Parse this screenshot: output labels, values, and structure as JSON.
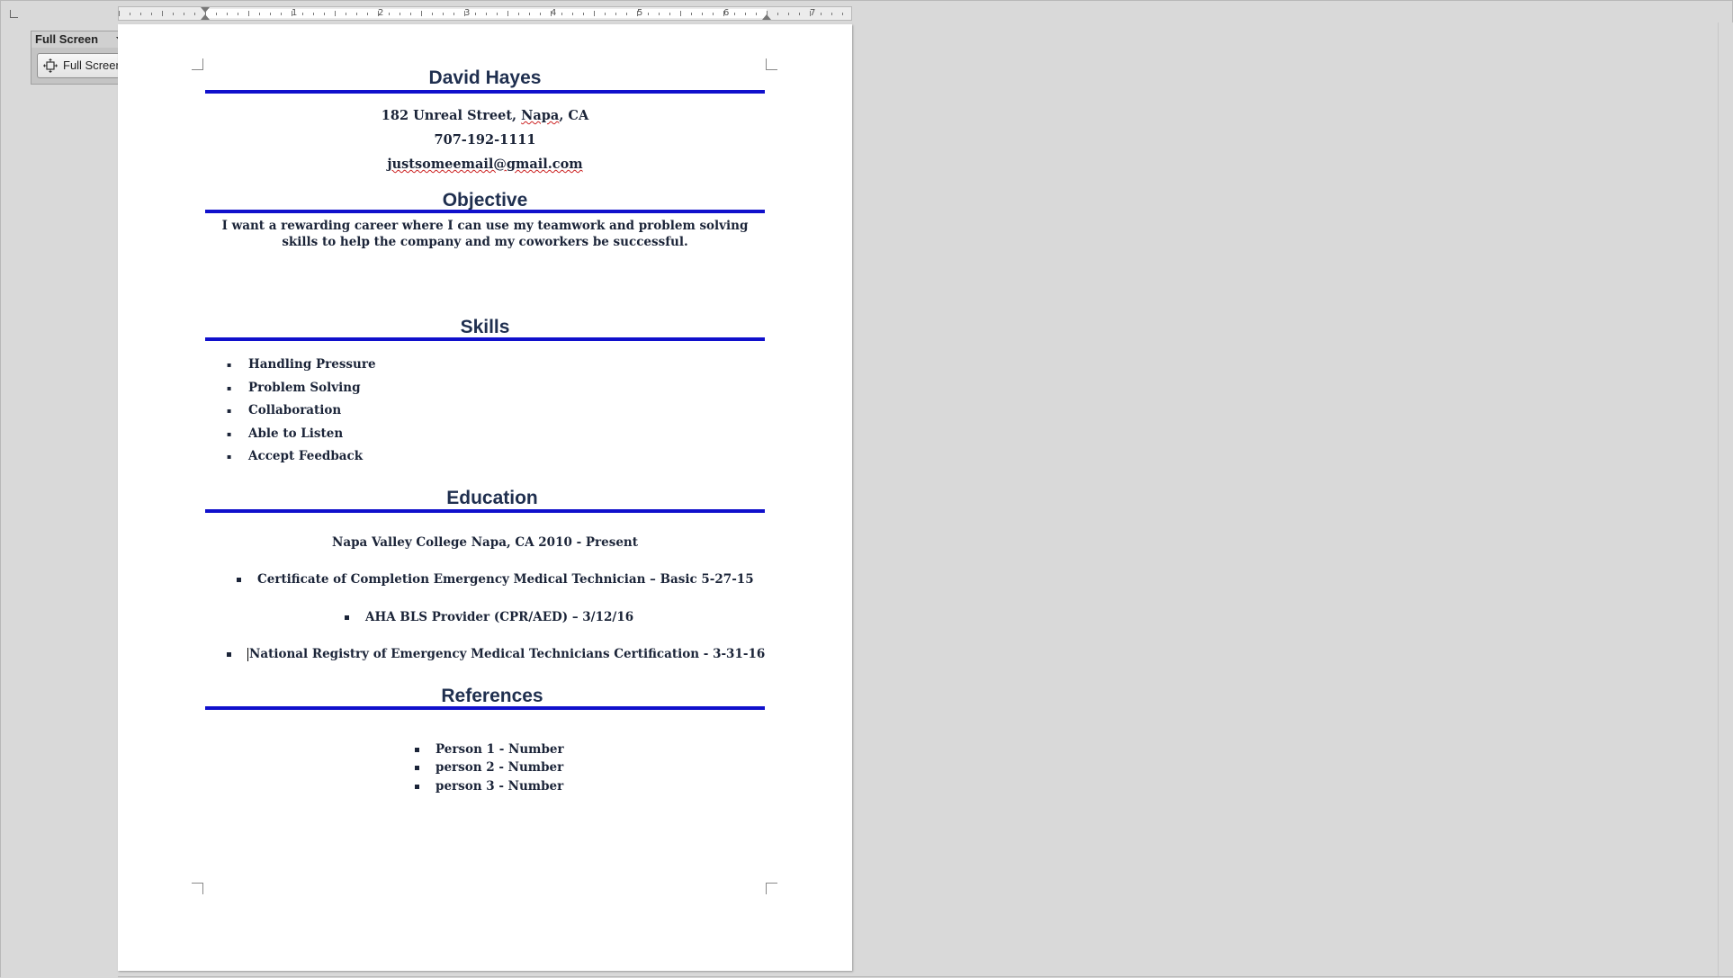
{
  "toolbar": {
    "panel_title": "Full Screen",
    "button_label": "Full Screen",
    "icon": "full-screen-icon"
  },
  "ruler": {
    "numbers": [
      "1",
      "2",
      "3",
      "4",
      "5",
      "6",
      "7"
    ]
  },
  "resume": {
    "name": "David Hayes",
    "address_prefix": "182 Unreal Street, ",
    "address_city": "Napa",
    "address_suffix": ", CA",
    "phone": "707-192-1111",
    "email": "justsomeemail@gmail.com",
    "objective_heading": "Objective",
    "objective_text": "I want a rewarding career where I can use my teamwork and problem solving skills to help the company and my coworkers be successful.",
    "skills_heading": "Skills",
    "skills": [
      "Handling Pressure",
      "Problem Solving",
      "Collaboration",
      "Able to Listen",
      "Accept Feedback"
    ],
    "education_heading": "Education",
    "education_school": "Napa Valley College  Napa, CA  2010 - Present",
    "education_items": [
      "Certificate of Completion Emergency Medical Technician – Basic 5-27-15",
      "AHA BLS Provider (CPR/AED) – 3/12/16",
      "National Registry of Emergency Medical Technicians Certification - 3-31-16"
    ],
    "references_heading": "References",
    "references": [
      "Person 1 - Number",
      "person 2 - Number",
      "person 3 - Number"
    ]
  },
  "colors": {
    "rule": "#1010cc",
    "heading": "#1f2f4f",
    "text": "#1b2438"
  }
}
